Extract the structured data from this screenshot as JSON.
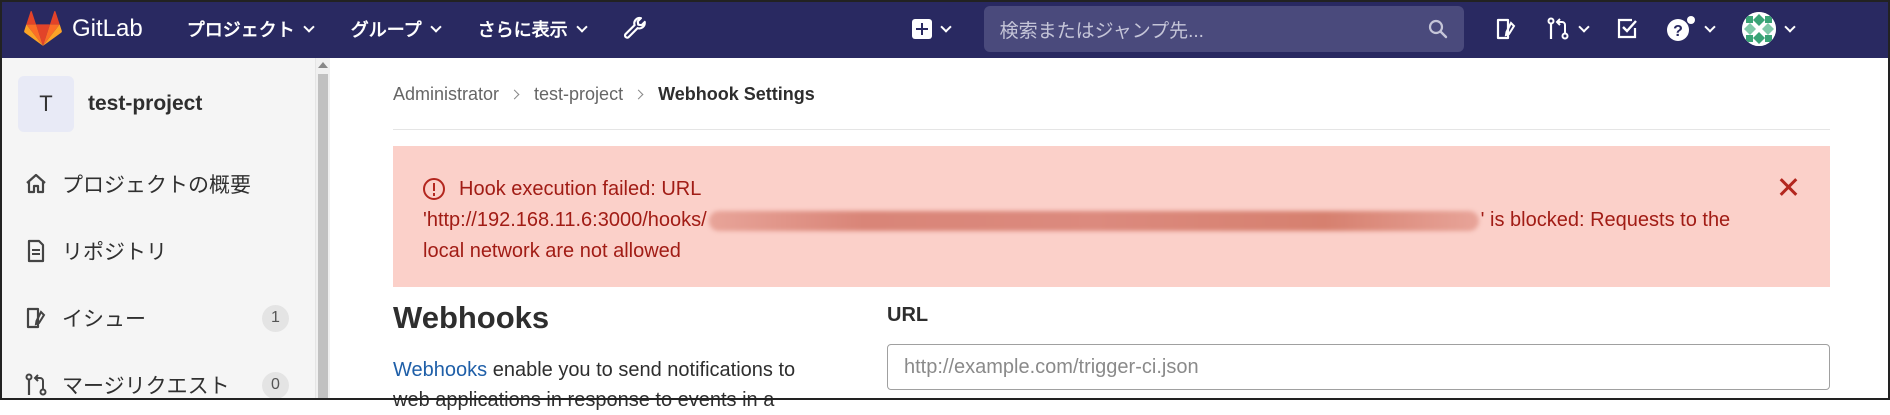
{
  "app": {
    "name": "GitLab"
  },
  "nav": {
    "projects": "プロジェクト",
    "groups": "グループ",
    "more": "さらに表示"
  },
  "search": {
    "placeholder": "検索またはジャンプ先..."
  },
  "sidebar": {
    "project_initial": "T",
    "project_name": "test-project",
    "items": [
      {
        "label": "プロジェクトの概要",
        "icon": "home-icon"
      },
      {
        "label": "リポジトリ",
        "icon": "document-icon"
      },
      {
        "label": "イシュー",
        "icon": "issues-icon",
        "count": "1"
      },
      {
        "label": "マージリクエスト",
        "icon": "merge-request-icon",
        "count": "0"
      }
    ]
  },
  "breadcrumb": [
    "Administrator",
    "test-project",
    "Webhook Settings"
  ],
  "alert": {
    "line1": "Hook execution failed: URL",
    "url_prefix": "'http://192.168.11.6:3000/hooks/",
    "url_suffix": "' is blocked: Requests to the local network are not allowed"
  },
  "webhooks": {
    "title": "Webhooks",
    "desc_link": "Webhooks",
    "desc_rest": " enable you to send notifications to web applications in response to events in a"
  },
  "form": {
    "url_label": "URL",
    "url_placeholder": "http://example.com/trigger-ci.json",
    "url_value": ""
  },
  "colors": {
    "topbar": "#292961",
    "alert_bg": "#fbd0c9",
    "alert_text": "#a11c15",
    "link": "#1f5fa8"
  }
}
